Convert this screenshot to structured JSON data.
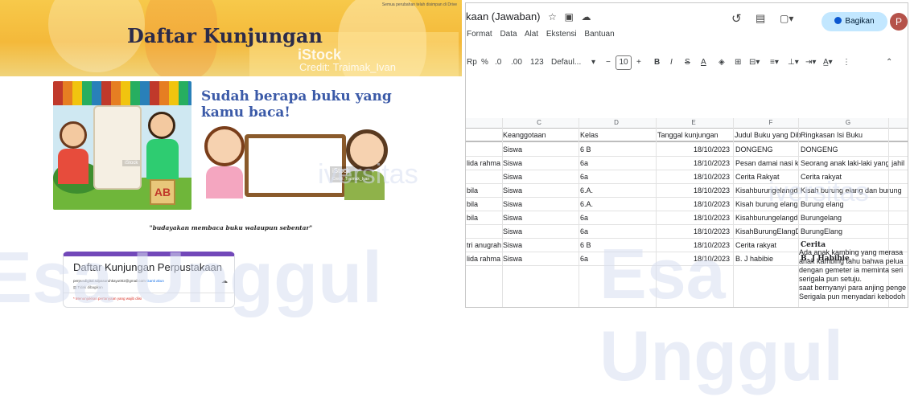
{
  "left": {
    "banner": {
      "top_note": "Semua perubahan telah disimpan di Drive",
      "title": "Daftar Kunjungan",
      "istock": "iStock",
      "credit": "Credit: Traimak_Ivan"
    },
    "kids_watermark": "iStock",
    "question": "Sudah berapa buku yang kamu baca!",
    "board_watermark": "iStock",
    "board_credit": "Credit: Traimak_Ivan",
    "motto": "\"budayakan membaca buku walaupun sebentar\"",
    "form": {
      "title": "Daftar Kunjungan Perpustakaan",
      "email": "perpusdigital.sdpasuruhkayu002@gmail.com",
      "switch_account": "Ganti akun",
      "not_shared": "Tidak dibagikan",
      "required_note": "* Menunjukkan pertanyaan yang wajib diisi"
    }
  },
  "right": {
    "doc_title": "kaan (Jawaban)",
    "menu": [
      "Format",
      "Data",
      "Alat",
      "Ekstensi",
      "Bantuan"
    ],
    "share_label": "Bagikan",
    "avatar_letter": "P",
    "toolbar": {
      "currency": "Rp",
      "percent": "%",
      "dec_down": ".0",
      "dec_up": ".00",
      "num_format": "123",
      "font": "Defaul...",
      "minus": "−",
      "size": "10",
      "plus": "+",
      "bold": "B",
      "italic": "I",
      "strike": "S",
      "text_color": "A"
    },
    "column_letters": [
      "C",
      "D",
      "E",
      "F",
      "G"
    ],
    "header_row": [
      "Keanggotaan",
      "Kelas",
      "Tanggal kunjungan",
      "Judul Buku yang Dibaca",
      "Ringkasan Isi Buku"
    ],
    "rows": [
      [
        "",
        "Siswa",
        "6 B",
        "18/10/2023",
        "DONGENG",
        "DONGENG"
      ],
      [
        "lida rahma",
        "Siswa",
        "6a",
        "18/10/2023",
        "Pesan damai nasi kemba",
        "Seorang anak laki-laki yang jahil"
      ],
      [
        "",
        "Siswa",
        "6a",
        "18/10/2023",
        "Cerita Rakyat",
        "Cerita rakyat"
      ],
      [
        "bila",
        "Siswa",
        "6.A.",
        "18/10/2023",
        "Kisahburungelangdanbu",
        "Kisah burung elang dan burung"
      ],
      [
        "bila",
        "Siswa",
        "6.A.",
        "18/10/2023",
        "Kisah burung elang dan b",
        "Burung elang"
      ],
      [
        "bila",
        "Siswa",
        "6a",
        "18/10/2023",
        "Kisahburungelangdanbu",
        "Burungelang"
      ],
      [
        "",
        "Siswa",
        "6a",
        "18/10/2023",
        "KisahBurungElangDanBu",
        "BurungElang"
      ],
      [
        "tri anugrah",
        "Siswa",
        "6 B",
        "18/10/2023",
        "Cerita rakyat",
        "Cerita"
      ],
      [
        "lida rahma",
        "Siswa",
        "6a",
        "18/10/2023",
        "B. J habibie",
        "B. J Habibie"
      ]
    ],
    "long_note": [
      "Ada anak kambing yang merasa",
      "anak kambing tahu bahwa pelua",
      "dengan gemeter ia meminta seri",
      "serigala pun setuju.",
      "saat bernyanyi para anjing penge",
      "Serigala pun menyadari kebodoh"
    ]
  },
  "watermark": {
    "esa": "Esa Unggul",
    "iv": "iversitas"
  }
}
